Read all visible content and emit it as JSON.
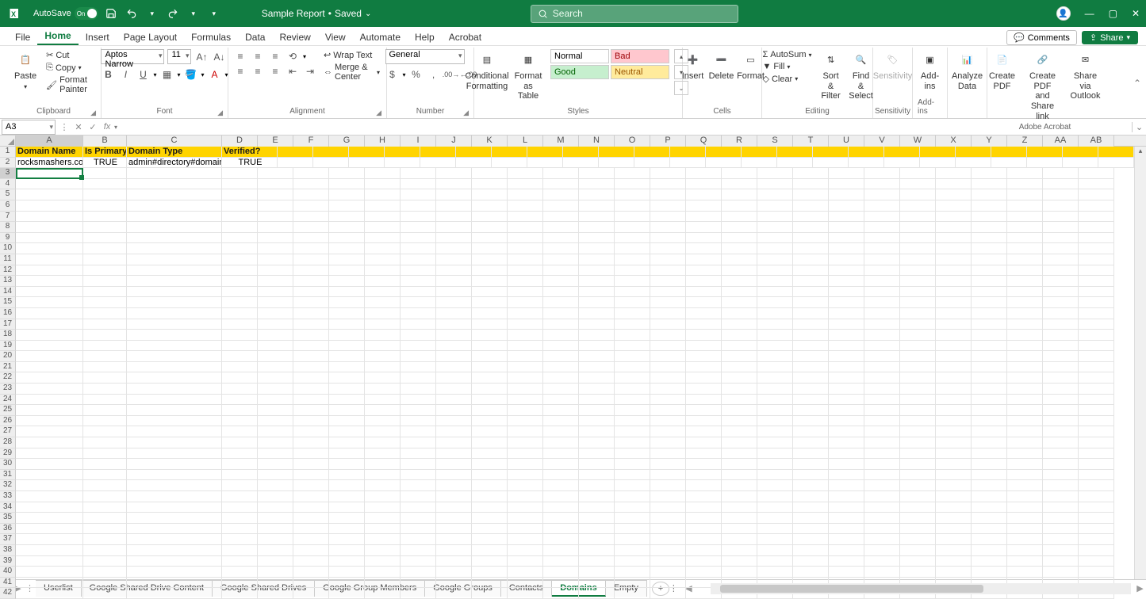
{
  "title": {
    "autosave": "AutoSave",
    "toggle": "On",
    "doc_name": "Sample Report",
    "saved": "Saved",
    "search_placeholder": "Search"
  },
  "tabs": {
    "file": "File",
    "home": "Home",
    "insert": "Insert",
    "page_layout": "Page Layout",
    "formulas": "Formulas",
    "data": "Data",
    "review": "Review",
    "view": "View",
    "automate": "Automate",
    "help": "Help",
    "acrobat": "Acrobat",
    "comments": "Comments",
    "share": "Share"
  },
  "ribbon": {
    "clipboard": {
      "paste": "Paste",
      "cut": "Cut",
      "copy": "Copy",
      "format_painter": "Format Painter",
      "label": "Clipboard"
    },
    "font": {
      "font_name": "Aptos Narrow",
      "font_size": "11",
      "label": "Font"
    },
    "alignment": {
      "wrap": "Wrap Text",
      "merge": "Merge & Center",
      "label": "Alignment"
    },
    "number": {
      "format": "General",
      "label": "Number"
    },
    "styles": {
      "cond": "Conditional Formatting",
      "table": "Format as Table",
      "normal": "Normal",
      "bad": "Bad",
      "good": "Good",
      "neutral": "Neutral",
      "label": "Styles"
    },
    "cells": {
      "insert": "Insert",
      "delete": "Delete",
      "format": "Format",
      "label": "Cells"
    },
    "editing": {
      "autosum": "AutoSum",
      "fill": "Fill",
      "clear": "Clear",
      "sort": "Sort & Filter",
      "find": "Find & Select",
      "label": "Editing"
    },
    "sensitivity": {
      "label": "Sensitivity",
      "btn": "Sensitivity"
    },
    "addins": {
      "label": "Add-ins",
      "btn": "Add-ins"
    },
    "analyze": {
      "label": "Analyze Data",
      "btn": "Analyze Data"
    },
    "acrobat": {
      "pdf": "Create PDF",
      "share": "Create PDF and Share link",
      "outlook": "Share via Outlook",
      "label": "Adobe Acrobat"
    }
  },
  "fxbar": {
    "ref": "A3",
    "value": ""
  },
  "columns": [
    "A",
    "B",
    "C",
    "D",
    "E",
    "F",
    "G",
    "H",
    "I",
    "J",
    "K",
    "L",
    "M",
    "N",
    "O",
    "P",
    "Q",
    "R",
    "S",
    "T",
    "U",
    "V",
    "W",
    "X",
    "Y",
    "Z",
    "AA",
    "AB"
  ],
  "sheet": {
    "header": [
      "Domain Name",
      "Is Primary?",
      "Domain Type",
      "Verified?"
    ],
    "row2": [
      "rocksmashers.com",
      "TRUE",
      "admin#directory#domain",
      "TRUE"
    ]
  },
  "sheets": [
    "Userlist",
    "Google Shared Drive Content",
    "Google Shared Drives",
    "Google Group Members",
    "Google Groups",
    "Contacts",
    "Domains",
    "Empty"
  ],
  "active_sheet": "Domains"
}
